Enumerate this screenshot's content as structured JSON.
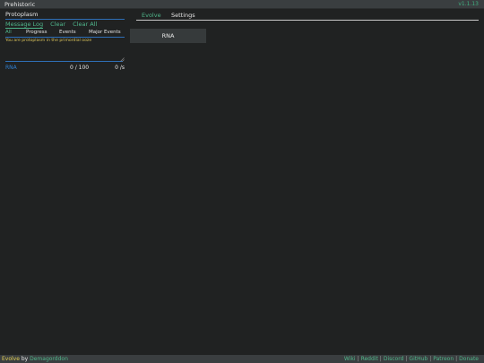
{
  "header": {
    "title": "Prehistoric",
    "version": "v1.1.13"
  },
  "left_panel": {
    "section_title": "Protoplasm",
    "message_controls": [
      "Message Log",
      "Clear",
      "Clear All"
    ],
    "filters": [
      "All",
      "Progress",
      "Events",
      "Major Events"
    ],
    "messages": [
      "You are protoplasm in the primordial ooze"
    ],
    "resources": [
      {
        "name": "RNA",
        "amount": "0 / 100",
        "rate": "0 /s"
      }
    ]
  },
  "main": {
    "tabs": [
      "Evolve",
      "Settings"
    ],
    "action_button": "RNA"
  },
  "footer": {
    "game_name": "Evolve",
    "by": " by ",
    "author": "Demagorddon",
    "links": [
      "Wiki",
      "Reddit",
      "Discord",
      "GitHub",
      "Patreon",
      "Donate"
    ],
    "separator": "|"
  },
  "colors": {
    "accent": "#4fb68a",
    "blue_rule": "#2e6fb7",
    "message": "#d9c35c",
    "background": "#202222"
  }
}
